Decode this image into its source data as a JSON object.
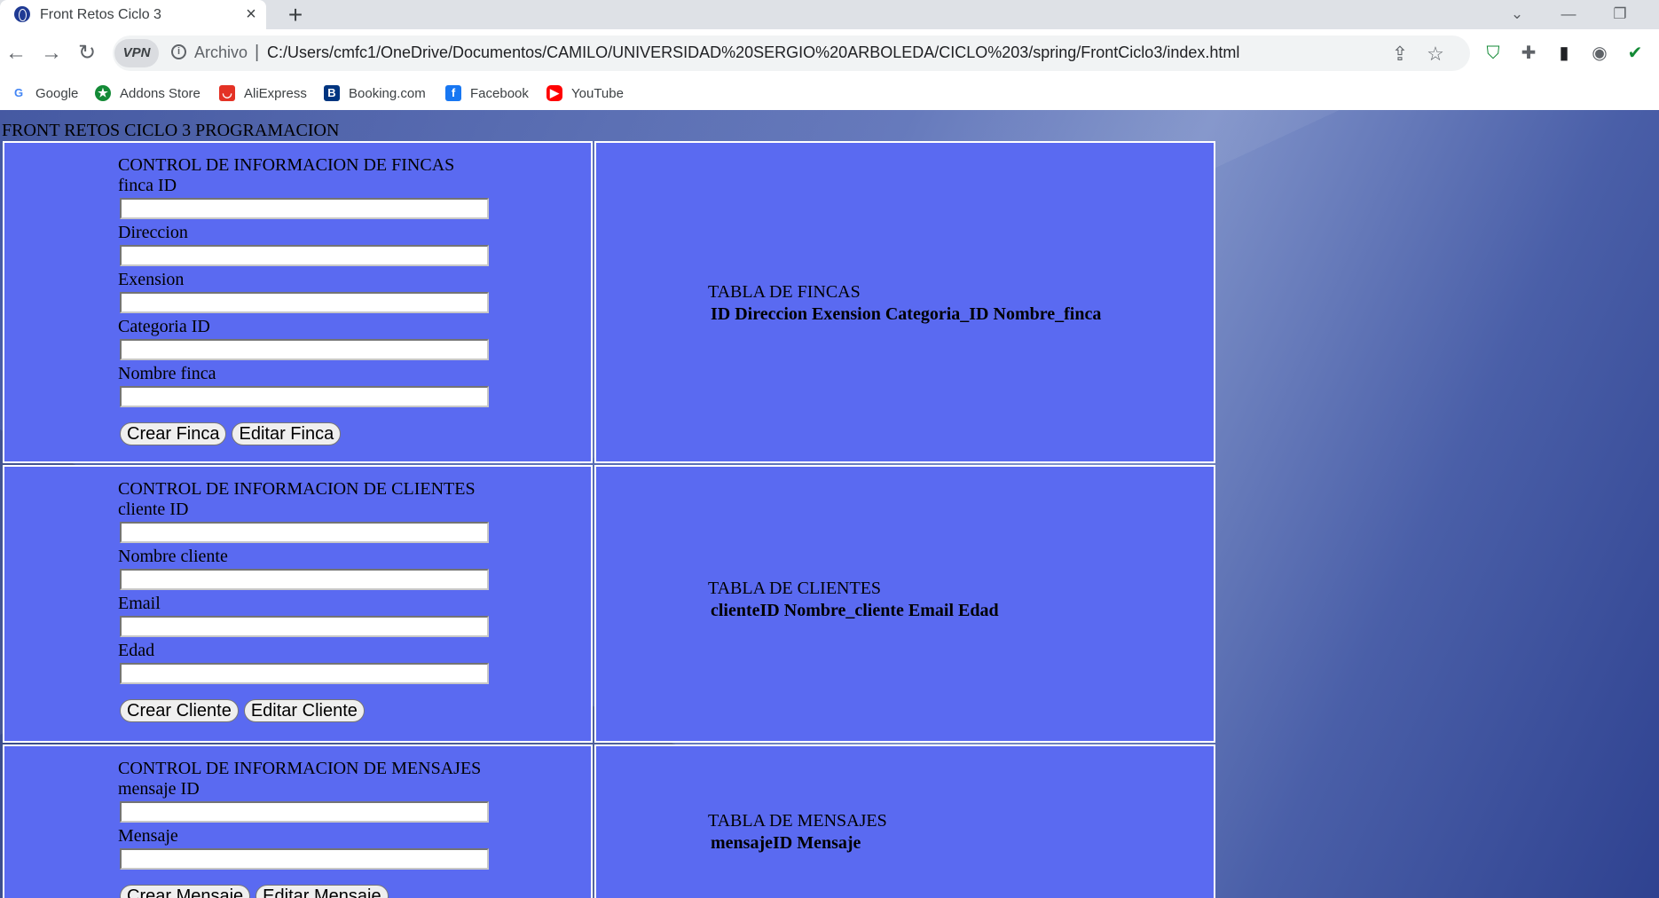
{
  "browser": {
    "tab_title": "Front Retos Ciclo 3",
    "tab_close": "×",
    "new_tab": "+",
    "vpn": "VPN",
    "scheme_label": "Archivo",
    "separator": "|",
    "url": "C:/Users/cmfc1/OneDrive/Documentos/CAMILO/UNIVERSIDAD%20SERGIO%20ARBOLEDA/CICLO%203/spring/FrontCiclo3/index.html",
    "bookmarks": [
      {
        "label": "Google",
        "icon": "google-icon",
        "color": "#4285f4"
      },
      {
        "label": "Addons Store",
        "icon": "addons-store-icon",
        "color": "#138a36"
      },
      {
        "label": "AliExpress",
        "icon": "aliexpress-icon",
        "color": "#e43225"
      },
      {
        "label": "Booking.com",
        "icon": "booking-icon",
        "color": "#003580"
      },
      {
        "label": "Facebook",
        "icon": "facebook-icon",
        "color": "#1877f2"
      },
      {
        "label": "YouTube",
        "icon": "youtube-icon",
        "color": "#ff0000"
      }
    ]
  },
  "page": {
    "heading": "FRONT RETOS CICLO 3 PROGRAMACION",
    "panel_color": "#5a6af1",
    "fincas": {
      "title": "CONTROL DE INFORMACION DE FINCAS",
      "fields": [
        "finca ID",
        "Direccion",
        "Exension",
        "Categoria ID",
        "Nombre finca"
      ],
      "create_button": "Crear Finca",
      "edit_button": "Editar Finca",
      "table_title": "TABLA DE FINCAS",
      "table_header": "ID Direccion Exension Categoria_ID Nombre_finca"
    },
    "clientes": {
      "title": "CONTROL DE INFORMACION DE CLIENTES",
      "fields": [
        "cliente ID",
        "Nombre cliente",
        "Email",
        "Edad"
      ],
      "create_button": "Crear Cliente",
      "edit_button": "Editar Cliente",
      "table_title": "TABLA DE CLIENTES",
      "table_header": "clienteID Nombre_cliente Email Edad"
    },
    "mensajes": {
      "title": "CONTROL DE INFORMACION DE MENSAJES",
      "fields": [
        "mensaje ID",
        "Mensaje"
      ],
      "create_button": "Crear Mensaje",
      "edit_button": "Editar Mensaje",
      "table_title": "TABLA DE MENSAJES",
      "table_header": "mensajeID Mensaje"
    }
  }
}
